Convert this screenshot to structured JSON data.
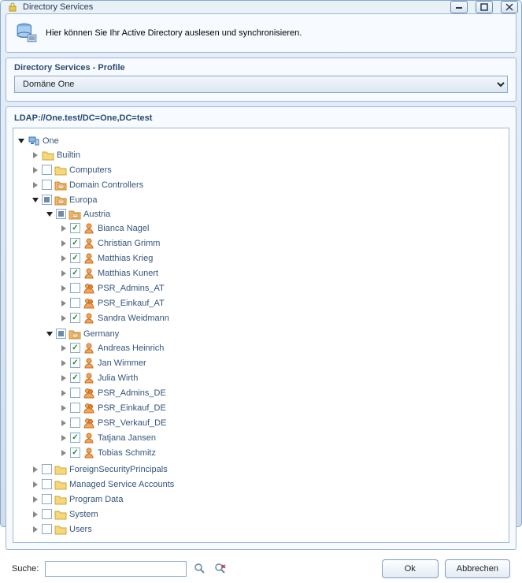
{
  "window": {
    "title": "Directory Services"
  },
  "banner": {
    "text": "Hier können Sie Ihr Active Directory auslesen und synchronisieren."
  },
  "profile": {
    "heading": "Directory Services - Profile",
    "selected": "Domäne One"
  },
  "ldap": {
    "label": "LDAP://One.test/DC=One,DC=test"
  },
  "tree": {
    "root": {
      "label": "One"
    },
    "builtin": {
      "label": "Builtin"
    },
    "computers": {
      "label": "Computers"
    },
    "domaincontrollers": {
      "label": "Domain Controllers"
    },
    "europa": {
      "label": "Europa"
    },
    "austria": {
      "label": "Austria"
    },
    "austria_items": {
      "n0": "Bianca Nagel",
      "n1": "Christian Grimm",
      "n2": "Matthias Krieg",
      "n3": "Matthias Kunert",
      "n4": "PSR_Admins_AT",
      "n5": "PSR_Einkauf_AT",
      "n6": "Sandra Weidmann"
    },
    "germany": {
      "label": "Germany"
    },
    "germany_items": {
      "n0": "Andreas Heinrich",
      "n1": "Jan Wimmer",
      "n2": "Julia Wirth",
      "n3": "PSR_Admins_DE",
      "n4": "PSR_Einkauf_DE",
      "n5": "PSR_Verkauf_DE",
      "n6": "Tatjana Jansen",
      "n7": "Tobias Schmitz"
    },
    "fsp": {
      "label": "ForeignSecurityPrincipals"
    },
    "msa": {
      "label": "Managed Service Accounts"
    },
    "pd": {
      "label": "Program Data"
    },
    "sys": {
      "label": "System"
    },
    "usr": {
      "label": "Users"
    }
  },
  "search": {
    "label": "Suche:",
    "placeholder": ""
  },
  "buttons": {
    "ok": "Ok",
    "cancel": "Abbrechen"
  }
}
